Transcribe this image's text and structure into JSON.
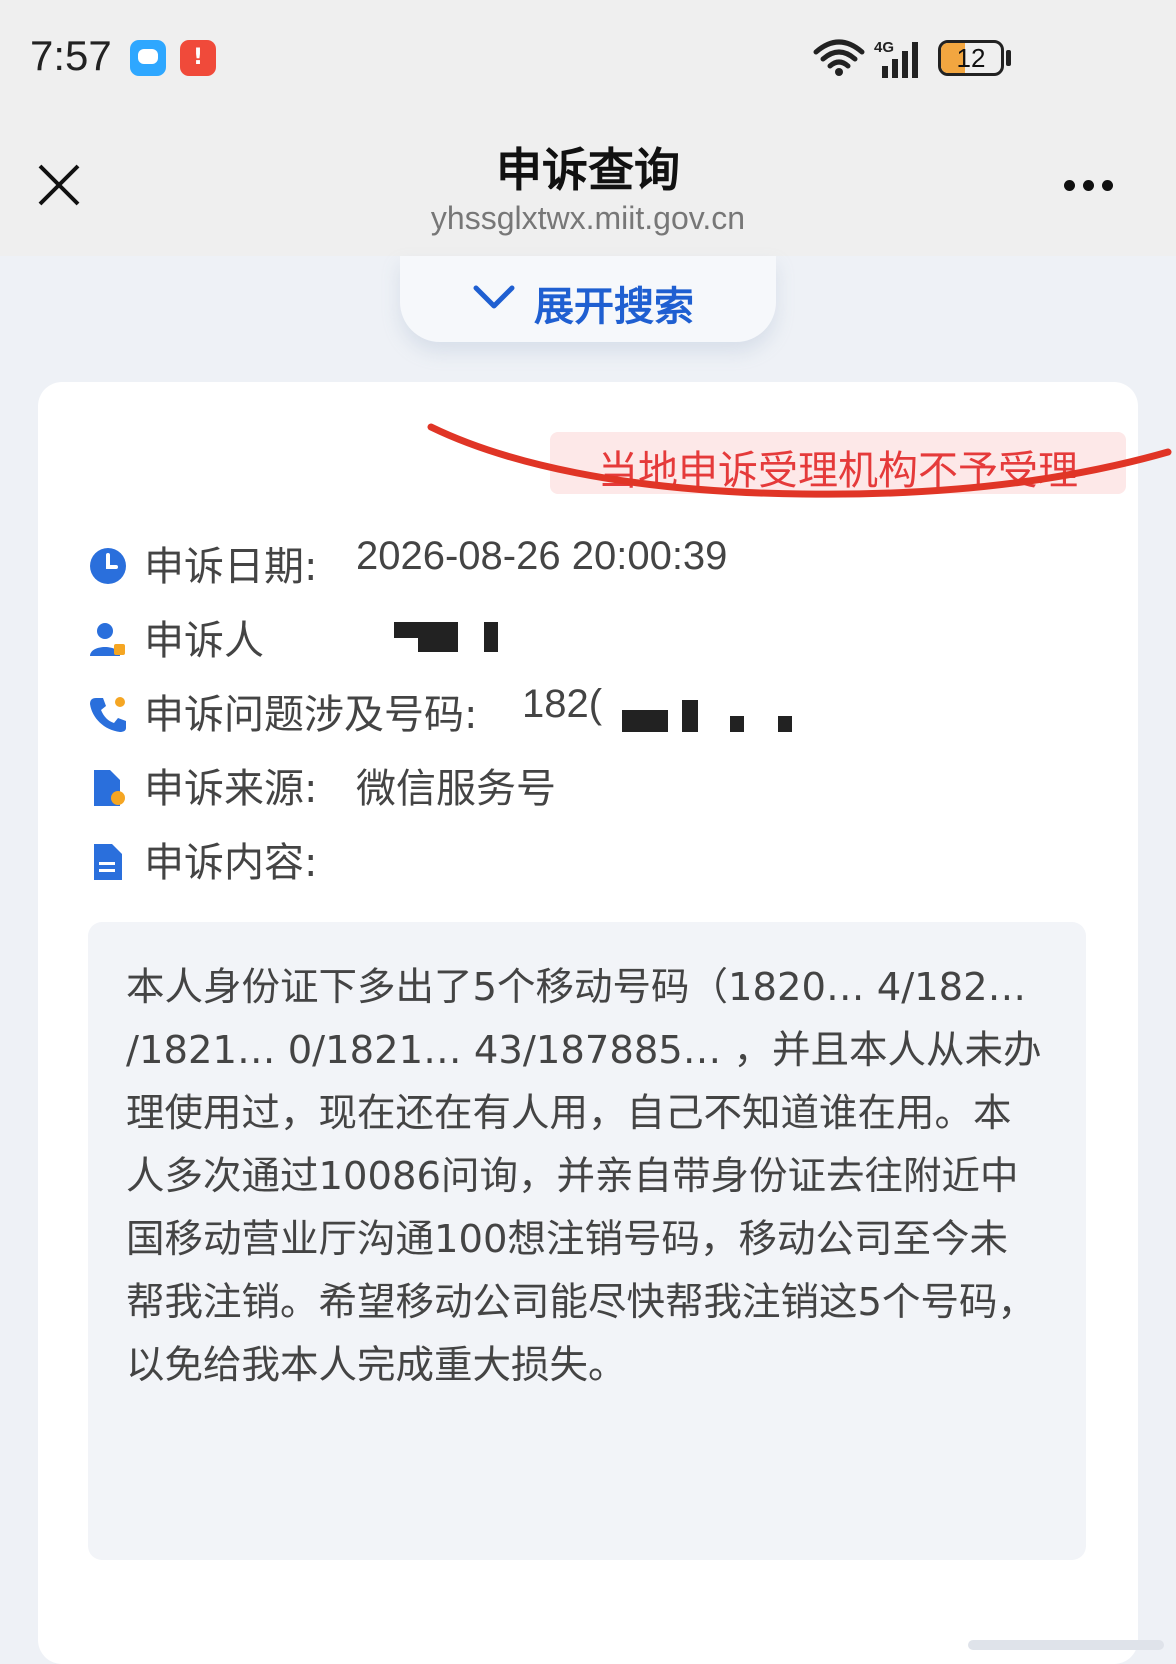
{
  "status_bar": {
    "time": "7:57",
    "alert_badge": "!",
    "network": "4G",
    "battery": {
      "label": "12",
      "level_percent": 12
    }
  },
  "nav": {
    "title": "申诉查询",
    "url": "yhssglxtwx.miit.gov.cn",
    "close_icon": "close-icon",
    "more_icon": "more-dots-icon"
  },
  "expand_search": {
    "label": "展开搜索",
    "icon": "chevron-down-icon"
  },
  "record": {
    "status": "当地申诉受理机构不予受理",
    "status_color": "#e53a3a",
    "date_label": "申诉日期:",
    "date_value": "2026-08-26 20:00:39",
    "complainant_label": "申诉人",
    "number_label": "申诉问题涉及号码:",
    "number_value": "182(",
    "source_label": "申诉来源:",
    "source_value": "微信服务号",
    "content_label": "申诉内容:",
    "content_text": "本人身份证下多出了5个移动号码（1820… 4/182… /1821… 0/1821… 43/187885… ，并且本人从未办理使用过，现在还在有人用，自己不知道谁在用。本人多次通过10086问询，并亲自带身份证去往附近中国移动营业厅沟通100想注销号码，移动公司至今未帮我注销。希望移动公司能尽快帮我注销这5个号码，以免给我本人完成重大损失。"
  },
  "colors": {
    "accent": "#1f5fd1",
    "icon_blue": "#2a6fdc",
    "icon_orange": "#f5a623",
    "mark_red": "#e03526"
  }
}
